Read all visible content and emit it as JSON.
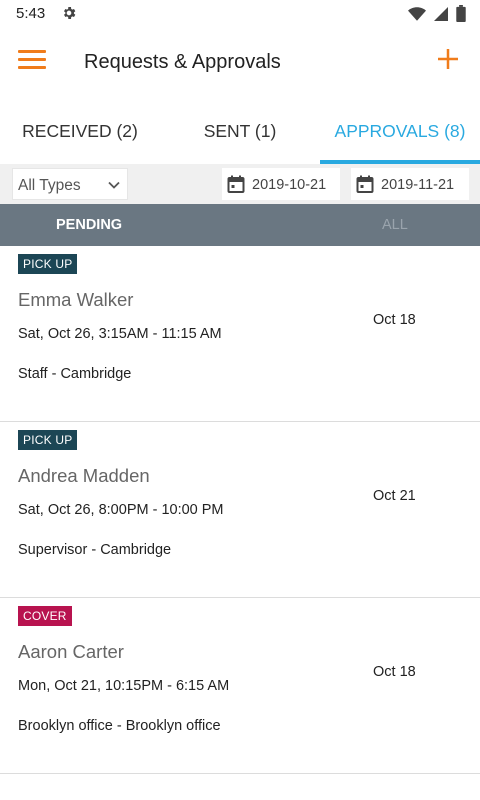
{
  "status_bar": {
    "time": "5:43"
  },
  "app_bar": {
    "title": "Requests & Approvals"
  },
  "tabs": [
    {
      "label": "RECEIVED (2)"
    },
    {
      "label": "SENT (1)"
    },
    {
      "label": "APPROVALS (8)"
    }
  ],
  "filters": {
    "type": "All Types",
    "from_date": "2019-10-21",
    "to_date": "2019-11-21"
  },
  "segments": {
    "pending": "PENDING",
    "all": "ALL"
  },
  "requests": [
    {
      "type": "PICK UP",
      "name": "Emma Walker",
      "when": "Sat, Oct 26, 3:15AM - 11:15 AM",
      "where": "Staff - Cambridge",
      "date": "Oct 18"
    },
    {
      "type": "PICK UP",
      "name": "Andrea Madden",
      "when": "Sat, Oct 26, 8:00PM - 10:00 PM",
      "where": "Supervisor - Cambridge",
      "date": "Oct 21"
    },
    {
      "type": "COVER",
      "name": "Aaron Carter",
      "when": "Mon, Oct 21, 10:15PM - 6:15 AM",
      "where": "Brooklyn office - Brooklyn office",
      "date": "Oct 18"
    }
  ],
  "colors": {
    "accent_orange": "#f07c1b",
    "active_tab": "#29a9e0",
    "pickup_badge": "#1c4655",
    "cover_badge": "#b8134f",
    "segment_bar": "#6a7782"
  }
}
